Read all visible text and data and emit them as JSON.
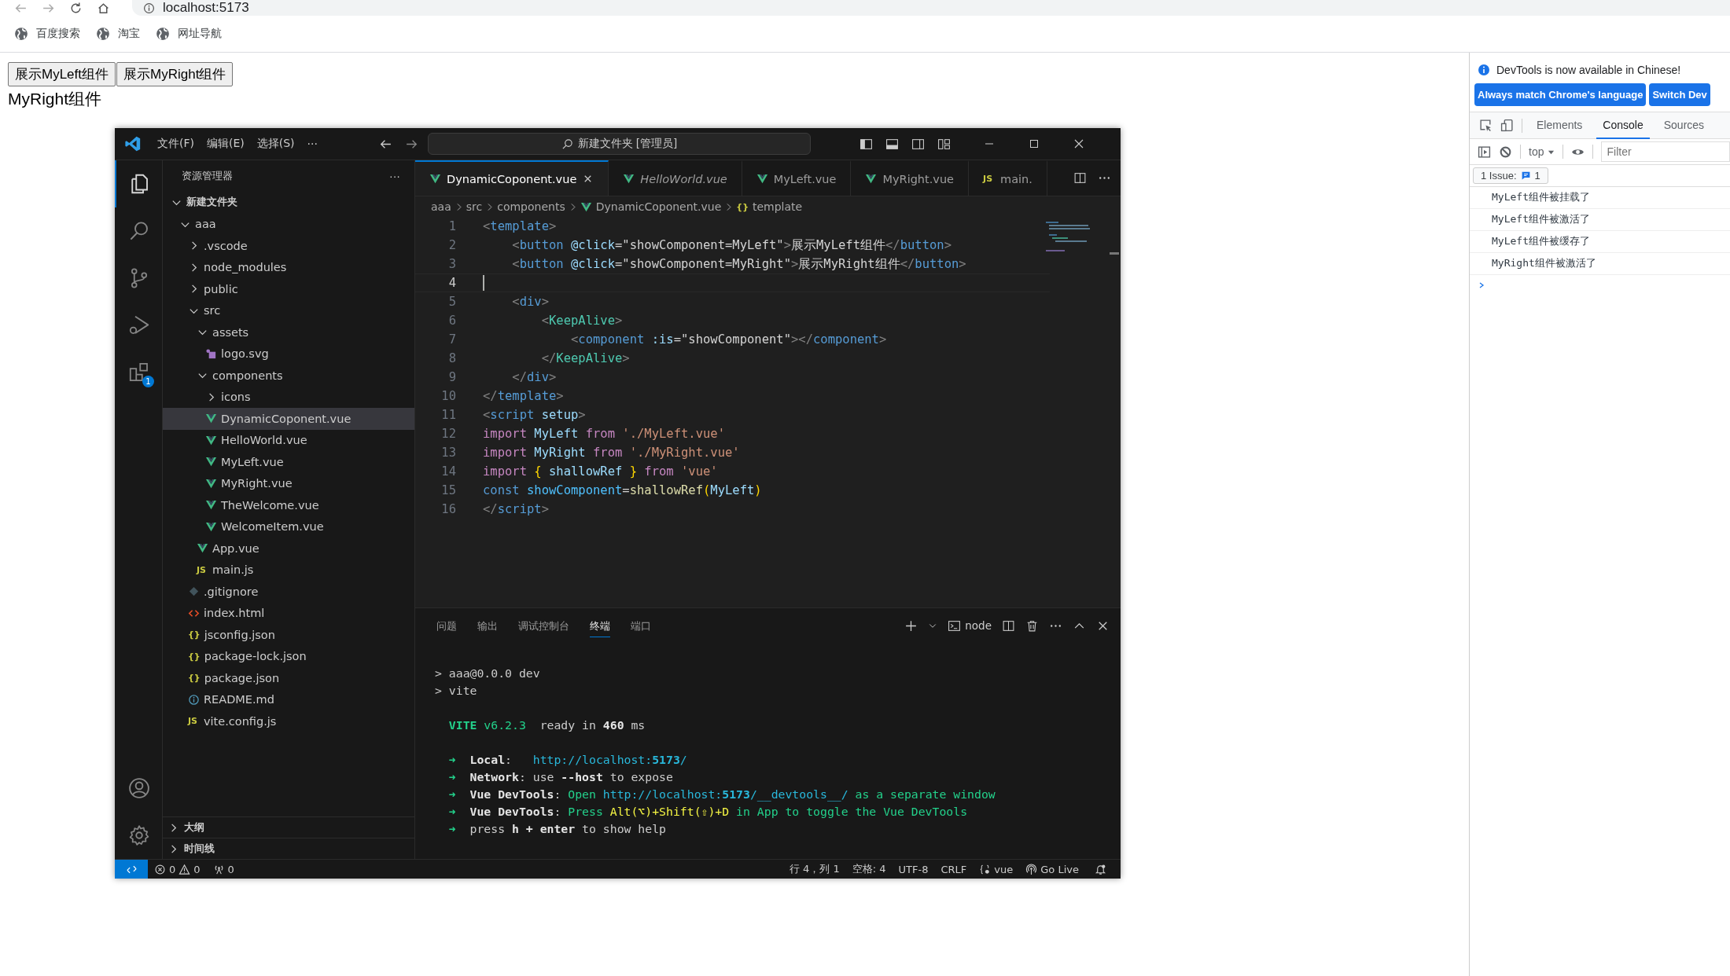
{
  "browser": {
    "url": "localhost:5173",
    "bookmarks": [
      "百度搜索",
      "淘宝",
      "网址导航"
    ]
  },
  "page": {
    "buttons": [
      "展示MyLeft组件",
      "展示MyRight组件"
    ],
    "text": "MyRight组件"
  },
  "vscode": {
    "menu": [
      "文件(F)",
      "编辑(E)",
      "选择(S)",
      "···"
    ],
    "command_center": "新建文件夹 [管理员]",
    "activity": [
      {
        "kind": "explorer",
        "selected": true
      },
      {
        "kind": "search",
        "selected": false
      },
      {
        "kind": "source-control",
        "selected": false
      },
      {
        "kind": "run-debug",
        "selected": false
      },
      {
        "kind": "extensions",
        "selected": false,
        "badge": "1"
      }
    ],
    "activity_bottom": [
      {
        "kind": "account"
      },
      {
        "kind": "settings"
      }
    ],
    "explorer": {
      "title": "资源管理器",
      "more": "···",
      "tree": [
        {
          "name": "新建文件夹",
          "kind": "root",
          "expanded": true,
          "selected": false,
          "children": [
            {
              "name": "aaa",
              "kind": "folder",
              "expanded": true,
              "selected": false,
              "children": [
                {
                  "name": ".vscode",
                  "kind": "folder",
                  "expanded": false,
                  "selected": false
                },
                {
                  "name": "node_modules",
                  "kind": "folder",
                  "expanded": false,
                  "selected": false
                },
                {
                  "name": "public",
                  "kind": "folder",
                  "expanded": false,
                  "selected": false
                },
                {
                  "name": "src",
                  "kind": "folder",
                  "expanded": true,
                  "selected": false,
                  "children": [
                    {
                      "name": "assets",
                      "kind": "folder",
                      "expanded": true,
                      "selected": false,
                      "children": [
                        {
                          "name": "logo.svg",
                          "kind": "image",
                          "selected": false
                        }
                      ]
                    },
                    {
                      "name": "components",
                      "kind": "folder",
                      "expanded": true,
                      "selected": false,
                      "children": [
                        {
                          "name": "icons",
                          "kind": "folder",
                          "expanded": false,
                          "selected": false
                        },
                        {
                          "name": "DynamicCoponent.vue",
                          "kind": "vue",
                          "selected": true
                        },
                        {
                          "name": "HelloWorld.vue",
                          "kind": "vue",
                          "selected": false
                        },
                        {
                          "name": "MyLeft.vue",
                          "kind": "vue",
                          "selected": false
                        },
                        {
                          "name": "MyRight.vue",
                          "kind": "vue",
                          "selected": false
                        },
                        {
                          "name": "TheWelcome.vue",
                          "kind": "vue",
                          "selected": false
                        },
                        {
                          "name": "WelcomeItem.vue",
                          "kind": "vue",
                          "selected": false
                        }
                      ]
                    },
                    {
                      "name": "App.vue",
                      "kind": "vue",
                      "selected": false
                    },
                    {
                      "name": "main.js",
                      "kind": "js",
                      "icon_text": "JS",
                      "selected": false
                    }
                  ]
                },
                {
                  "name": ".gitignore",
                  "kind": "git",
                  "selected": false
                },
                {
                  "name": "index.html",
                  "kind": "html",
                  "selected": false
                },
                {
                  "name": "jsconfig.json",
                  "kind": "json",
                  "icon_text": "{}",
                  "selected": false
                },
                {
                  "name": "package-lock.json",
                  "kind": "json",
                  "icon_text": "{}",
                  "selected": false
                },
                {
                  "name": "package.json",
                  "kind": "json",
                  "icon_text": "{}",
                  "selected": false
                },
                {
                  "name": "README.md",
                  "kind": "info",
                  "selected": false
                },
                {
                  "name": "vite.config.js",
                  "kind": "js",
                  "icon_text": "JS",
                  "selected": false
                }
              ]
            }
          ]
        }
      ],
      "sections": [
        {
          "label": "大纲",
          "expanded": false
        },
        {
          "label": "时间线",
          "expanded": false
        }
      ]
    },
    "editor_tabs": [
      {
        "label": "DynamicCoponent.vue",
        "kind": "vue",
        "selected": true,
        "preview": false
      },
      {
        "label": "HelloWorld.vue",
        "kind": "vue",
        "selected": false,
        "preview": true
      },
      {
        "label": "MyLeft.vue",
        "kind": "vue",
        "selected": false,
        "preview": false
      },
      {
        "label": "MyRight.vue",
        "kind": "vue",
        "selected": false,
        "preview": false
      },
      {
        "label": "main.",
        "kind": "js",
        "icon_text": "JS",
        "selected": false,
        "preview": false
      }
    ],
    "breadcrumb": [
      {
        "label": "aaa",
        "kind": "folder"
      },
      {
        "label": "src",
        "kind": "folder"
      },
      {
        "label": "components",
        "kind": "folder"
      },
      {
        "label": "DynamicCoponent.vue",
        "kind": "vue"
      },
      {
        "label": "template",
        "kind": "symbol",
        "icon_text": "{}"
      }
    ],
    "code_lines": [
      {
        "number": "1",
        "current": false,
        "tokens": [
          {
            "text": "<",
            "kind": "punct"
          },
          {
            "text": "template",
            "kind": "tag"
          },
          {
            "text": ">",
            "kind": "punct"
          }
        ]
      },
      {
        "number": "2",
        "current": false,
        "tokens": [
          {
            "text": "    <",
            "kind": "punct"
          },
          {
            "text": "button",
            "kind": "tag"
          },
          {
            "text": " @click",
            "kind": "attr"
          },
          {
            "text": "=\"showComponent=MyLeft\"",
            "kind": "plain"
          },
          {
            "text": ">",
            "kind": "punct"
          },
          {
            "text": "展示MyLeft组件",
            "kind": "plain"
          },
          {
            "text": "</",
            "kind": "punct"
          },
          {
            "text": "button",
            "kind": "tag"
          },
          {
            "text": ">",
            "kind": "punct"
          }
        ]
      },
      {
        "number": "3",
        "current": false,
        "tokens": [
          {
            "text": "    <",
            "kind": "punct"
          },
          {
            "text": "button",
            "kind": "tag"
          },
          {
            "text": " @click",
            "kind": "attr"
          },
          {
            "text": "=\"showComponent=MyRight\"",
            "kind": "plain"
          },
          {
            "text": ">",
            "kind": "punct"
          },
          {
            "text": "展示MyRight组件",
            "kind": "plain"
          },
          {
            "text": "</",
            "kind": "punct"
          },
          {
            "text": "button",
            "kind": "tag"
          },
          {
            "text": ">",
            "kind": "punct"
          }
        ]
      },
      {
        "number": "4",
        "current": true
      },
      {
        "number": "5",
        "current": false,
        "tokens": [
          {
            "text": "    <",
            "kind": "punct"
          },
          {
            "text": "div",
            "kind": "tag"
          },
          {
            "text": ">",
            "kind": "punct"
          }
        ]
      },
      {
        "number": "6",
        "current": false,
        "tokens": [
          {
            "text": "        <",
            "kind": "punct"
          },
          {
            "text": "KeepAlive",
            "kind": "component"
          },
          {
            "text": ">",
            "kind": "punct"
          }
        ]
      },
      {
        "number": "7",
        "current": false,
        "tokens": [
          {
            "text": "            <",
            "kind": "punct"
          },
          {
            "text": "component",
            "kind": "tag"
          },
          {
            "text": " :is",
            "kind": "attr"
          },
          {
            "text": "=\"showComponent\"",
            "kind": "plain"
          },
          {
            "text": "></",
            "kind": "punct"
          },
          {
            "text": "component",
            "kind": "tag"
          },
          {
            "text": ">",
            "kind": "punct"
          }
        ]
      },
      {
        "number": "8",
        "current": false,
        "tokens": [
          {
            "text": "        </",
            "kind": "punct"
          },
          {
            "text": "KeepAlive",
            "kind": "component"
          },
          {
            "text": ">",
            "kind": "punct"
          }
        ]
      },
      {
        "number": "9",
        "current": false,
        "tokens": [
          {
            "text": "    </",
            "kind": "punct"
          },
          {
            "text": "div",
            "kind": "tag"
          },
          {
            "text": ">",
            "kind": "punct"
          }
        ]
      },
      {
        "number": "10",
        "current": false,
        "tokens": [
          {
            "text": "</",
            "kind": "punct"
          },
          {
            "text": "template",
            "kind": "tag"
          },
          {
            "text": ">",
            "kind": "punct"
          }
        ]
      },
      {
        "number": "11",
        "current": false,
        "tokens": [
          {
            "text": "<",
            "kind": "punct"
          },
          {
            "text": "script",
            "kind": "tag"
          },
          {
            "text": " setup",
            "kind": "attr"
          },
          {
            "text": ">",
            "kind": "punct"
          }
        ]
      },
      {
        "number": "12",
        "current": false,
        "tokens": [
          {
            "text": "import",
            "kind": "keyword"
          },
          {
            "text": " MyLeft ",
            "kind": "variable"
          },
          {
            "text": "from",
            "kind": "keyword"
          },
          {
            "text": " './MyLeft.vue'",
            "kind": "string"
          }
        ]
      },
      {
        "number": "13",
        "current": false,
        "tokens": [
          {
            "text": "import",
            "kind": "keyword"
          },
          {
            "text": " MyRight ",
            "kind": "variable"
          },
          {
            "text": "from",
            "kind": "keyword"
          },
          {
            "text": " './MyRight.vue'",
            "kind": "string"
          }
        ]
      },
      {
        "number": "14",
        "current": false,
        "tokens": [
          {
            "text": "import",
            "kind": "keyword"
          },
          {
            "text": " {",
            "kind": "bracket"
          },
          {
            "text": " shallowRef ",
            "kind": "variable"
          },
          {
            "text": "}",
            "kind": "bracket"
          },
          {
            "text": " from",
            "kind": "keyword"
          },
          {
            "text": " 'vue'",
            "kind": "string"
          }
        ]
      },
      {
        "number": "15",
        "current": false,
        "tokens": [
          {
            "text": "const",
            "kind": "declare"
          },
          {
            "text": " showComponent",
            "kind": "constant"
          },
          {
            "text": "=",
            "kind": "plain"
          },
          {
            "text": "shallowRef",
            "kind": "function"
          },
          {
            "text": "(",
            "kind": "bracket"
          },
          {
            "text": "MyLeft",
            "kind": "variable"
          },
          {
            "text": ")",
            "kind": "bracket"
          }
        ]
      },
      {
        "number": "16",
        "current": false,
        "tokens": [
          {
            "text": "</",
            "kind": "punct"
          },
          {
            "text": "script",
            "kind": "tag"
          },
          {
            "text": ">",
            "kind": "punct"
          }
        ]
      }
    ],
    "panel_tabs": [
      {
        "label": "问题",
        "selected": false
      },
      {
        "label": "输出",
        "selected": false
      },
      {
        "label": "调试控制台",
        "selected": false
      },
      {
        "label": "终端",
        "selected": true
      },
      {
        "label": "端口",
        "selected": false
      }
    ],
    "terminal_name": "node",
    "terminal_blocks": [
      [
        {
          "tokens": [
            {
              "text": "> aaa@0.0.0 dev",
              "kind": "plain"
            }
          ]
        },
        {
          "tokens": [
            {
              "text": "> vite",
              "kind": "plain"
            }
          ]
        }
      ],
      [
        {
          "tokens": [
            {
              "text": "  VITE",
              "kind": "green-bold"
            },
            {
              "text": " v6.2.3",
              "kind": "green"
            },
            {
              "text": "  ready in ",
              "kind": "plain"
            },
            {
              "text": "460",
              "kind": "bold"
            },
            {
              "text": " ms",
              "kind": "plain"
            }
          ]
        }
      ],
      [
        {
          "tokens": [
            {
              "text": "  ➜  ",
              "kind": "green"
            },
            {
              "text": "Local",
              "kind": "bold"
            },
            {
              "text": ":   ",
              "kind": "plain"
            },
            {
              "text": "http://localhost:",
              "kind": "cyan"
            },
            {
              "text": "5173",
              "kind": "cyan-bold"
            },
            {
              "text": "/",
              "kind": "cyan"
            }
          ]
        },
        {
          "tokens": [
            {
              "text": "  ➜  ",
              "kind": "green"
            },
            {
              "text": "Network",
              "kind": "bold"
            },
            {
              "text": ": use ",
              "kind": "plain"
            },
            {
              "text": "--host",
              "kind": "bold"
            },
            {
              "text": " to expose",
              "kind": "plain"
            }
          ]
        },
        {
          "tokens": [
            {
              "text": "  ➜  ",
              "kind": "green"
            },
            {
              "text": "Vue DevTools",
              "kind": "bold"
            },
            {
              "text": ": ",
              "kind": "plain"
            },
            {
              "text": "Open ",
              "kind": "green"
            },
            {
              "text": "http://localhost:",
              "kind": "cyan"
            },
            {
              "text": "5173",
              "kind": "cyan-bold"
            },
            {
              "text": "/__devtools__/",
              "kind": "cyan"
            },
            {
              "text": " as a separate window",
              "kind": "green"
            }
          ]
        },
        {
          "tokens": [
            {
              "text": "  ➜  ",
              "kind": "green"
            },
            {
              "text": "Vue DevTools",
              "kind": "bold"
            },
            {
              "text": ": ",
              "kind": "plain"
            },
            {
              "text": "Press ",
              "kind": "green"
            },
            {
              "text": "Alt(⌥)+Shift(⇧)+D",
              "kind": "yellow"
            },
            {
              "text": " in App to toggle the Vue DevTools",
              "kind": "green"
            }
          ]
        },
        {
          "tokens": [
            {
              "text": "  ➜  ",
              "kind": "green"
            },
            {
              "text": "press ",
              "kind": "plain"
            },
            {
              "text": "h + enter",
              "kind": "bold"
            },
            {
              "text": " to show help",
              "kind": "plain"
            }
          ]
        }
      ]
    ],
    "status_left": [
      {
        "kind": "remote"
      },
      {
        "kind": "problems",
        "errors": "0",
        "warnings": "0"
      },
      {
        "kind": "ports",
        "text": "0"
      }
    ],
    "status_right": [
      {
        "kind": "text",
        "text": "行 4，列 1"
      },
      {
        "kind": "text",
        "text": "空格: 4"
      },
      {
        "kind": "text",
        "text": "UTF-8"
      },
      {
        "kind": "text",
        "text": "CRLF"
      },
      {
        "kind": "language",
        "text": "vue"
      },
      {
        "kind": "live",
        "text": "Go Live"
      },
      {
        "kind": "bell"
      }
    ]
  },
  "devtools": {
    "notice": "DevTools is now available in Chinese!",
    "notice_buttons": [
      "Always match Chrome's language",
      "Switch Dev"
    ],
    "tabs": [
      {
        "label": "Elements",
        "selected": false
      },
      {
        "label": "Console",
        "selected": true
      },
      {
        "label": "Sources",
        "selected": false
      }
    ],
    "context": "top",
    "filter_placeholder": "Filter",
    "issues": {
      "label": "1 Issue:",
      "count": "1"
    },
    "messages": [
      "MyLeft组件被挂载了",
      "MyLeft组件被激活了",
      "MyLeft组件被缓存了",
      "MyRight组件被激活了"
    ]
  }
}
